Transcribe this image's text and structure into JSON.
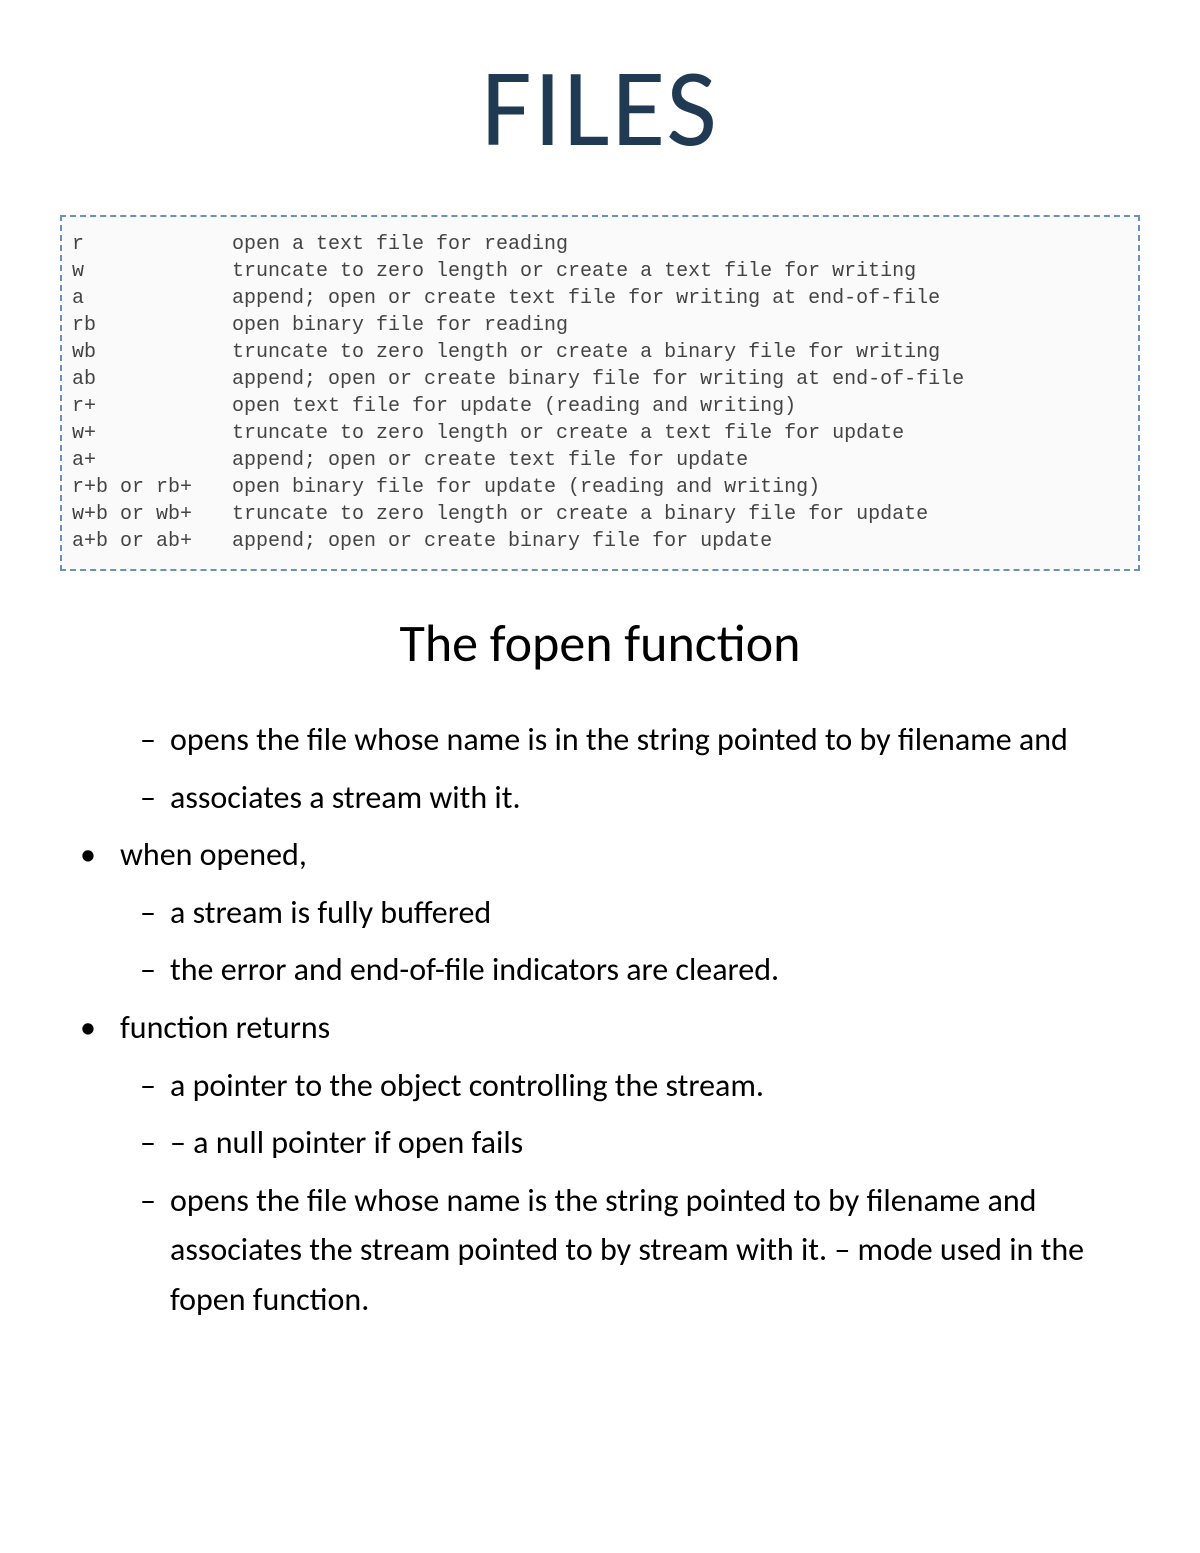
{
  "title": "FILES",
  "modes": [
    {
      "mode": "r",
      "desc": "open a text file for reading"
    },
    {
      "mode": "w",
      "desc": "truncate to zero length or create a text file for writing"
    },
    {
      "mode": "a",
      "desc": "append; open or create text file for writing at end-of-file"
    },
    {
      "mode": "rb",
      "desc": "open binary file for reading"
    },
    {
      "mode": "wb",
      "desc": "truncate to zero length or create a binary file for writing"
    },
    {
      "mode": "ab",
      "desc": "append; open or create binary file for writing at end-of-file"
    },
    {
      "mode": "r+",
      "desc": "open text file for update (reading and writing)"
    },
    {
      "mode": "w+",
      "desc": "truncate to zero length or create a text file for update"
    },
    {
      "mode": "a+",
      "desc": "append; open or create text file for update"
    },
    {
      "mode": "r+b or rb+",
      "desc": "open binary file for update (reading and writing)"
    },
    {
      "mode": "w+b or wb+",
      "desc": "truncate to zero length or create a binary file for update"
    },
    {
      "mode": "a+b or ab+",
      "desc": "append; open or create binary file for update"
    }
  ],
  "subtitle": "The fopen function",
  "body": {
    "intro_sub1": "opens the file whose name is in the string pointed to by filename and",
    "intro_sub2": "associates a stream with it.",
    "bullet1": "when opened,",
    "b1_sub1": "a stream is fully buffered",
    "b1_sub2": "the error and end-of-file indicators are cleared.",
    "bullet2": "function returns",
    "b2_sub1": "a pointer to the object controlling the stream.",
    "b2_sub2": "– a null pointer if open fails",
    "b2_sub3": "opens the file whose name is the string pointed to by filename and associates the stream pointed to by stream with it. – mode used in the fopen function."
  }
}
